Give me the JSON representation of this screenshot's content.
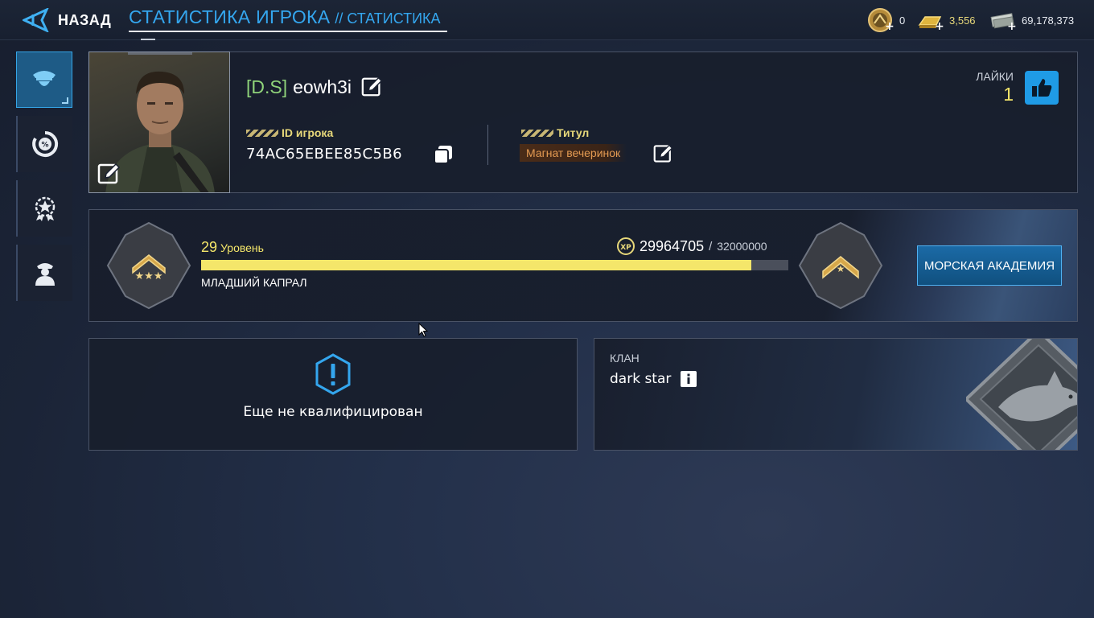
{
  "topbar": {
    "back_label": "НАЗАД",
    "title": "СТАТИСТИКА ИГРОКА",
    "subtitle": "// СТАТИСТИКА",
    "currencies": [
      {
        "icon": "medal-coin-icon",
        "value": "0",
        "color": "#e8ecf2"
      },
      {
        "icon": "gold-bar-icon",
        "value": "3,556",
        "color": "#e7d87a"
      },
      {
        "icon": "cash-stack-icon",
        "value": "69,178,373",
        "color": "#e8ecf2"
      }
    ]
  },
  "sidebar": {
    "items": [
      {
        "name": "sidebar-item-profile",
        "icon": "officer-cap-icon",
        "active": true
      },
      {
        "name": "sidebar-item-percent",
        "icon": "percent-gauge-icon",
        "active": false
      },
      {
        "name": "sidebar-item-achievements",
        "icon": "star-medal-icon",
        "active": false
      },
      {
        "name": "sidebar-item-crew",
        "icon": "soldier-icon",
        "active": false
      }
    ]
  },
  "profile": {
    "clan_tag": "[D.S]",
    "player_name": "eowh3i",
    "id_label": "ID игрока",
    "id_value": "74AC65EBEE85C5B6",
    "title_label": "Титул",
    "title_value": "Магнат вечеринок",
    "likes_label": "ЛАЙКИ",
    "likes_value": "1"
  },
  "level": {
    "number": "29",
    "level_label": "Уровень",
    "rank_name": "МЛАДШИЙ КАПРАЛ",
    "xp_current": "29964705",
    "xp_separator": "/",
    "xp_target": "32000000",
    "progress": 0.9364,
    "academy_button": "МОРСКАЯ АКАДЕМИЯ"
  },
  "qualification": {
    "status_text": "Еще не квалифицирован"
  },
  "clan": {
    "label": "КЛАН",
    "name": "dark star"
  },
  "colors": {
    "accent_blue": "#34a6ee",
    "gold": "#e7d87a",
    "progress": "#f4e66a",
    "clan_tag": "#8fd37a",
    "title_badge": "#e39a52"
  }
}
